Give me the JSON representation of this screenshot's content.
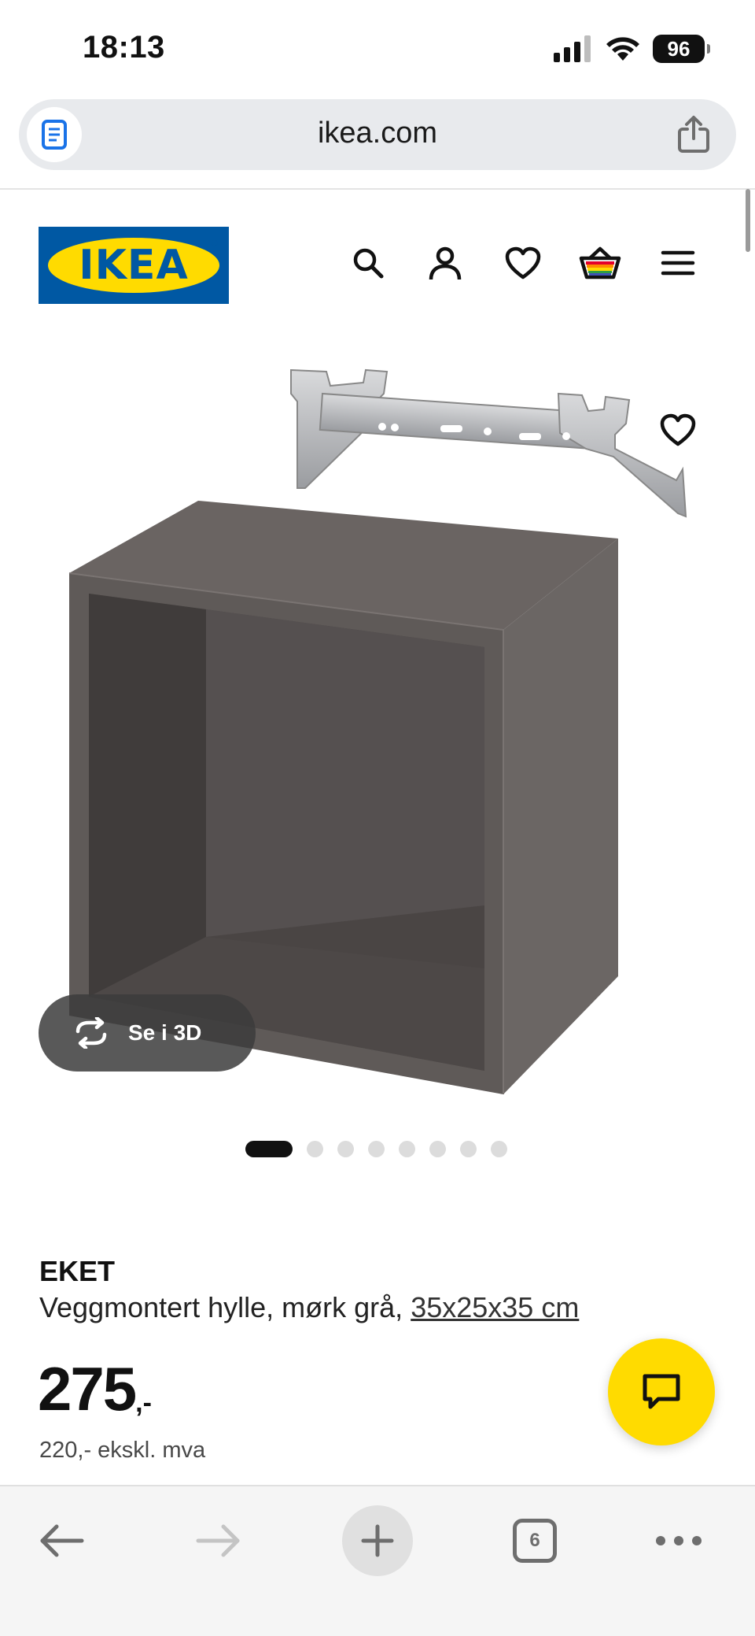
{
  "status_bar": {
    "time": "18:13",
    "battery": "96"
  },
  "browser": {
    "url": "ikea.com",
    "tab_count": "6"
  },
  "header": {
    "logo_text": "IKEA"
  },
  "gallery": {
    "view_3d_label": "Se i 3D",
    "image_count": 8,
    "active_index": 0
  },
  "product": {
    "name": "EKET",
    "description": "Veggmontert hylle, mørk grå,",
    "size": "35x25x35 cm",
    "price": "275",
    "price_suffix": ",-",
    "price_excl_vat": "220,- ekskl. mva"
  },
  "colors": {
    "ikea_blue": "#0058a3",
    "ikea_yellow": "#ffdb00",
    "cabinet_gray": "#5f5a58"
  }
}
